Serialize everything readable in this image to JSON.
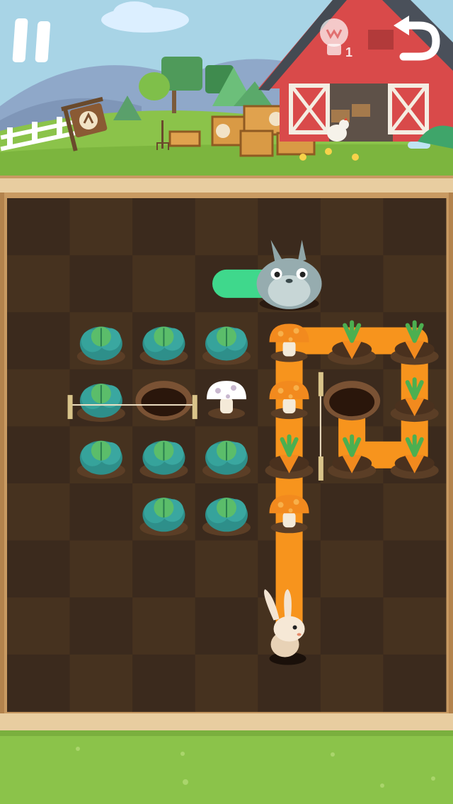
{
  "hud": {
    "pause_icon": "pause-icon",
    "hint_icon": "lightbulb-icon",
    "hint_count": "1",
    "undo_icon": "undo-arrow-icon"
  },
  "board": {
    "cols": 7,
    "rows": 9,
    "cells": [
      {
        "type": "cabbage",
        "row": 2,
        "col": 1
      },
      {
        "type": "cabbage",
        "row": 2,
        "col": 2
      },
      {
        "type": "cabbage",
        "row": 2,
        "col": 3
      },
      {
        "type": "cabbage",
        "row": 3,
        "col": 1
      },
      {
        "type": "hole",
        "row": 3,
        "col": 2
      },
      {
        "type": "white-mushroom",
        "row": 3,
        "col": 3
      },
      {
        "type": "hole",
        "row": 3,
        "col": 5
      },
      {
        "type": "cabbage",
        "row": 4,
        "col": 1
      },
      {
        "type": "cabbage",
        "row": 4,
        "col": 2
      },
      {
        "type": "cabbage",
        "row": 4,
        "col": 3
      },
      {
        "type": "cabbage",
        "row": 5,
        "col": 2
      },
      {
        "type": "cabbage",
        "row": 5,
        "col": 3
      },
      {
        "type": "orange-mushroom",
        "row": 2,
        "col": 4
      },
      {
        "type": "orange-mushroom",
        "row": 3,
        "col": 4
      },
      {
        "type": "orange-mushroom",
        "row": 5,
        "col": 4
      },
      {
        "type": "carrot",
        "row": 2,
        "col": 5
      },
      {
        "type": "carrot",
        "row": 2,
        "col": 6
      },
      {
        "type": "carrot",
        "row": 3,
        "col": 6
      },
      {
        "type": "carrot",
        "row": 4,
        "col": 4
      },
      {
        "type": "carrot",
        "row": 4,
        "col": 5
      },
      {
        "type": "carrot",
        "row": 4,
        "col": 6
      }
    ],
    "fences": [
      {
        "row": 3,
        "from_col": 1,
        "to_col": 2
      },
      {
        "col": 5,
        "from_row": 3,
        "to_row": 4
      }
    ],
    "path": [
      [
        7,
        4
      ],
      [
        6,
        4
      ],
      [
        5,
        4
      ],
      [
        4,
        4
      ],
      [
        3,
        4
      ],
      [
        2,
        4
      ],
      [
        2,
        5
      ],
      [
        2,
        6
      ],
      [
        3,
        6
      ],
      [
        4,
        6
      ],
      [
        4,
        5
      ],
      [
        3,
        5
      ]
    ],
    "player": {
      "name": "bunny",
      "row": 7,
      "col": 4
    },
    "goal": {
      "name": "fat-rabbit",
      "row": 1,
      "col": 4
    }
  },
  "scene": {
    "signpost_icon": "farm-sign-icon",
    "barn": "red-barn"
  },
  "colors": {
    "path": "#f7941d",
    "goal_bar": "#3fd88c",
    "soil_dark": "#3b2a1d",
    "soil_light": "#46321f",
    "frame": "#c89a62",
    "grass": "#8bc34a",
    "barn": "#d94a4a"
  }
}
